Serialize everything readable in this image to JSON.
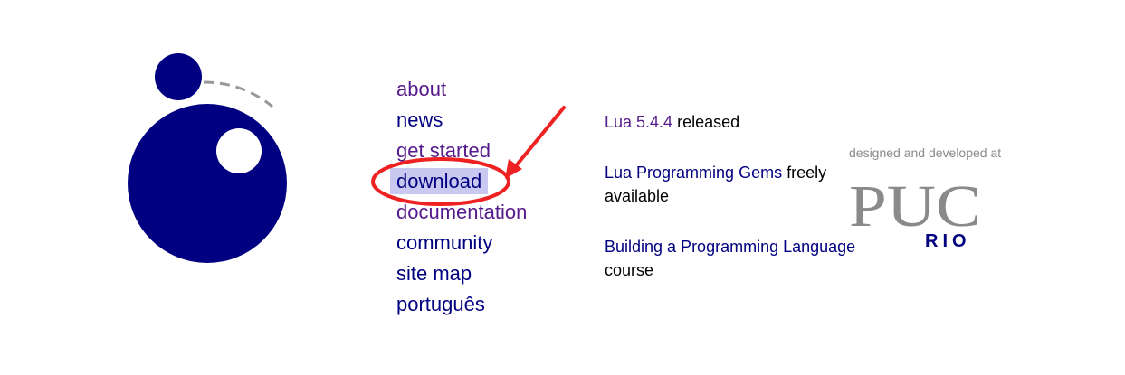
{
  "nav": {
    "items": [
      {
        "label": "about",
        "visited": true
      },
      {
        "label": "news",
        "visited": false
      },
      {
        "label": "get started",
        "visited": true
      },
      {
        "label": "download",
        "visited": false,
        "highlighted": true
      },
      {
        "label": "documentation",
        "visited": true
      },
      {
        "label": "community",
        "visited": false
      },
      {
        "label": "site map",
        "visited": false
      },
      {
        "label": "português",
        "visited": false
      }
    ]
  },
  "news": {
    "items": [
      {
        "link": "Lua 5.4.4",
        "rest": " released"
      },
      {
        "link": "Lua Programming Gems",
        "rest": " freely available"
      },
      {
        "link": "Building a Programming Language",
        "rest": " course"
      }
    ]
  },
  "credit": {
    "caption": "designed and developed at",
    "logo_text": "PUC",
    "logo_subtext": "RIO"
  },
  "colors": {
    "lua_blue": "#000080",
    "visited_purple": "#551a8b",
    "highlight": "#c8c8f0",
    "annotation_red": "#ee2222",
    "puc_gray": "#8a8a8a"
  },
  "icons": {
    "logo": "lua-logo-icon",
    "annotation": "red-arrow-annotation"
  }
}
